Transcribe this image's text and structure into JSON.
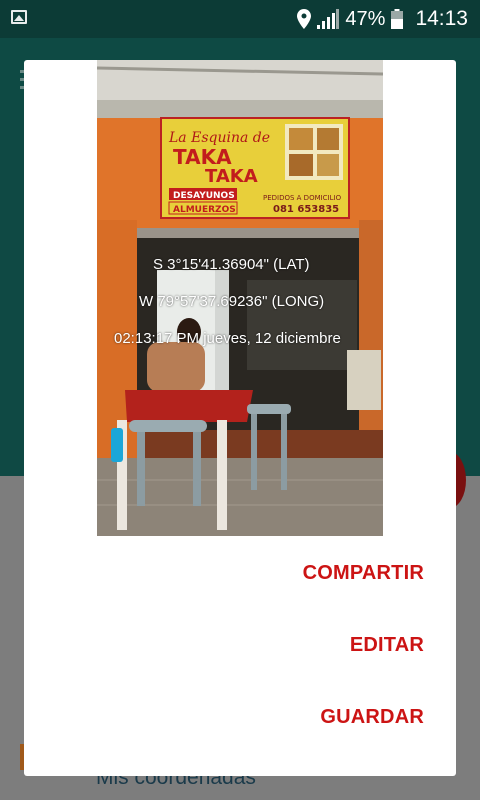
{
  "status_bar": {
    "battery": "47%",
    "time": "14:13",
    "icons": [
      "image-icon",
      "location-icon",
      "signal-icon",
      "battery-icon"
    ]
  },
  "background": {
    "link_text": "Mis coordenadas"
  },
  "photo": {
    "sign_title_small": "La Esquina de",
    "sign_title_1": "TAKA",
    "sign_title_2": "TAKA",
    "sign_line_1": "DESAYUNOS",
    "sign_line_2": "ALMUERZOS",
    "sign_delivery": "PEDIDOS A DOMICILIO",
    "sign_phone": "081 653835",
    "lat": "S 3°15'41.36904\" (LAT)",
    "long": "W 79°57'37.69236\" (LONG)",
    "timestamp": "02:13:17 PM jueves, 12 diciembre"
  },
  "dialog": {
    "actions": {
      "share": "COMPARTIR",
      "edit": "EDITAR",
      "save": "GUARDAR"
    }
  },
  "colors": {
    "accent": "#cc1414",
    "status_bar": "#0c3b36",
    "app_teal": "#0f4944"
  }
}
